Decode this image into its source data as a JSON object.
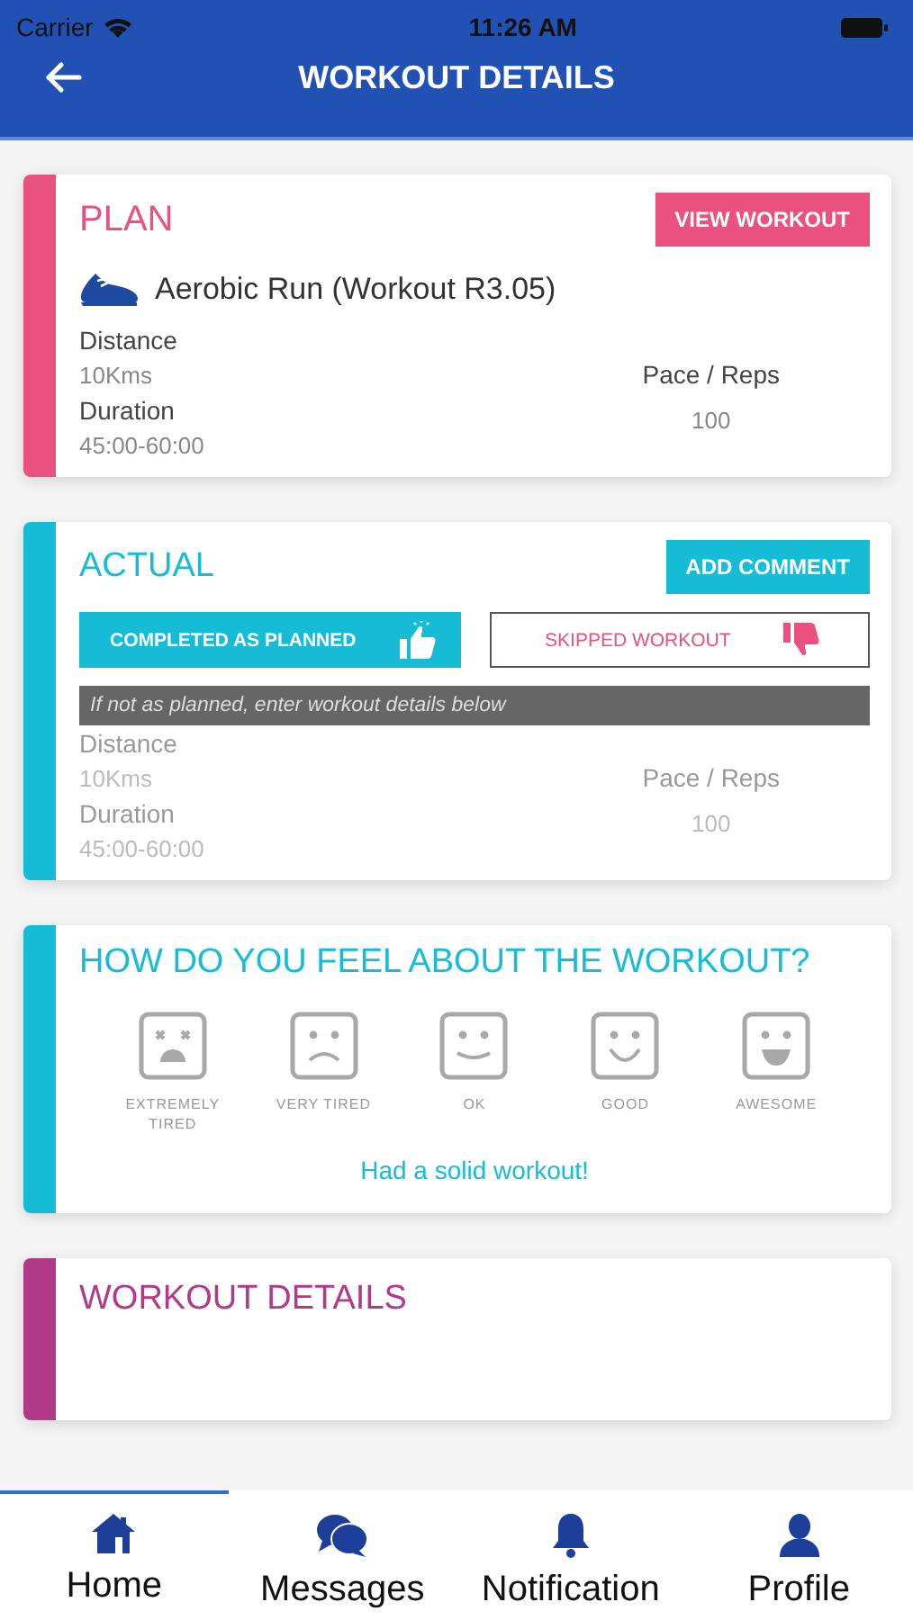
{
  "status_bar": {
    "carrier": "Carrier",
    "time": "11:26 AM"
  },
  "header": {
    "title": "WORKOUT DETAILS"
  },
  "plan": {
    "title": "PLAN",
    "button": "VIEW WORKOUT",
    "workout": "Aerobic Run (Workout R3.05)",
    "distance_label": "Distance",
    "distance": "10Kms",
    "duration_label": "Duration",
    "duration": "45:00-60:00",
    "pace_label": "Pace / Reps",
    "pace": "100"
  },
  "actual": {
    "title": "ACTUAL",
    "button": "ADD COMMENT",
    "outcomes": [
      {
        "label": "COMPLETED AS PLANNED",
        "kind": "up",
        "selected": true
      },
      {
        "label": "SKIPPED WORKOUT",
        "kind": "down",
        "selected": false
      }
    ],
    "hint": "If not as planned, enter workout details below",
    "distance_label": "Distance",
    "distance": "10Kms",
    "duration_label": "Duration",
    "duration": "45:00-60:00",
    "pace_label": "Pace / Reps",
    "pace": "100"
  },
  "feeling": {
    "title": "HOW DO YOU FEEL ABOUT THE WORKOUT?",
    "moods": [
      {
        "label": "EXTREMELY TIRED",
        "kind": "dead"
      },
      {
        "label": "VERY TIRED",
        "kind": "sad"
      },
      {
        "label": "OK",
        "kind": "ok"
      },
      {
        "label": "GOOD",
        "kind": "good"
      },
      {
        "label": "AWESOME",
        "kind": "awesome"
      }
    ],
    "comment": "Had a solid workout!"
  },
  "details": {
    "title": "WORKOUT DETAILS"
  },
  "tabs": [
    {
      "label": "Home",
      "kind": "home",
      "selected": true
    },
    {
      "label": "Messages",
      "kind": "messages",
      "selected": false
    },
    {
      "label": "Notification",
      "kind": "bell",
      "selected": false
    },
    {
      "label": "Profile",
      "kind": "person",
      "selected": false
    }
  ]
}
